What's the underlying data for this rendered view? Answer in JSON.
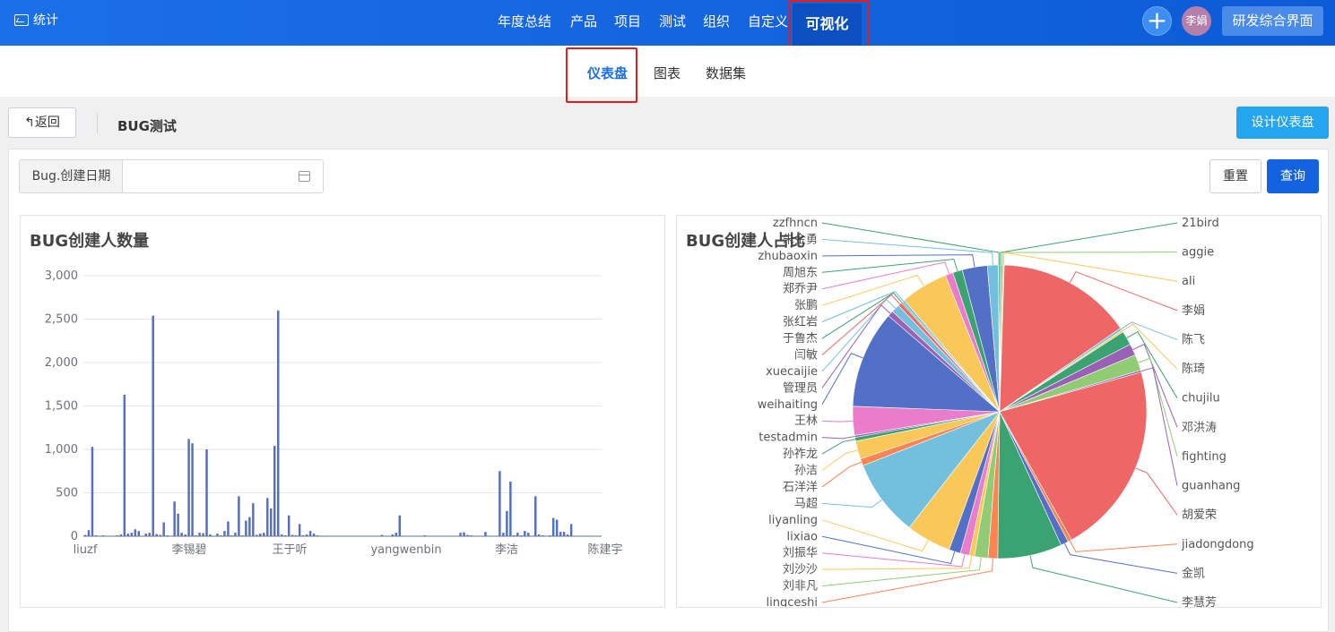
{
  "header": {
    "app_name": "统计",
    "nav": [
      "年度总结",
      "产品",
      "项目",
      "测试",
      "组织",
      "自定义",
      "可视化"
    ],
    "active_nav": "可视化",
    "user_avatar": "李娟",
    "switch_button": "研发综合界面",
    "plus_symbol": "+"
  },
  "subnav": {
    "items": [
      "仪表盘",
      "图表",
      "数据集"
    ],
    "active": "仪表盘"
  },
  "toolbar": {
    "back_label": "返回",
    "title": "BUG测试",
    "design_label": "设计仪表盘"
  },
  "filter": {
    "label": "Bug.创建日期",
    "value": "",
    "reset_label": "重置",
    "query_label": "查询"
  },
  "colors": {
    "header": "#1b6fe8",
    "accent": "#1a6de6",
    "highlight": "#e51c1c",
    "bar": "#5470c6"
  },
  "chart_data": [
    {
      "type": "bar",
      "title": "BUG创建人数量",
      "xlabel": "",
      "ylabel": "",
      "ylim": [
        0,
        3000
      ],
      "yticks": [
        "0",
        "500",
        "1,000",
        "1,500",
        "2,000",
        "2,500",
        "3,000"
      ],
      "x_tick_labels": [
        "liuzf",
        "李锡碧",
        "王于听",
        "yangwenbin",
        "李洁",
        "陈建宇"
      ],
      "grid": true,
      "values": [
        15,
        70,
        1030,
        10,
        5,
        10,
        5,
        0,
        5,
        10,
        20,
        1630,
        30,
        40,
        80,
        60,
        5,
        30,
        40,
        2540,
        25,
        15,
        160,
        10,
        5,
        400,
        260,
        40,
        20,
        1120,
        1070,
        10,
        40,
        35,
        1000,
        20,
        0,
        30,
        10,
        60,
        170,
        10,
        40,
        460,
        10,
        180,
        220,
        380,
        15,
        30,
        40,
        440,
        320,
        1040,
        2600,
        20,
        10,
        240,
        15,
        10,
        140,
        10,
        20,
        60,
        30,
        10,
        5,
        5,
        5,
        5,
        5,
        5,
        5,
        5,
        5,
        5,
        5,
        5,
        5,
        5,
        5,
        5,
        5,
        15,
        5,
        5,
        20,
        40,
        240,
        5,
        5,
        5,
        5,
        5,
        5,
        10,
        5,
        5,
        5,
        5,
        5,
        5,
        5,
        5,
        5,
        40,
        45,
        15,
        10,
        5,
        5,
        5,
        50,
        5,
        5,
        5,
        750,
        40,
        290,
        630,
        10,
        40,
        10,
        60,
        40,
        5,
        460,
        20,
        10,
        5,
        10,
        210,
        190,
        50,
        50,
        20,
        140,
        5,
        5,
        5,
        5,
        5,
        5,
        5,
        5
      ]
    },
    {
      "type": "pie",
      "title": "BUG创建人占比",
      "labels": [
        "21bird",
        "aggie",
        "ali",
        "李娟",
        "陈飞",
        "陈琦",
        "chujilu",
        "邓洪涛",
        "fighting",
        "guanhang",
        "胡爱荣",
        "jiadongdong",
        "金凯",
        "李慧芳",
        "lingceshi",
        "刘非凡",
        "刘沙沙",
        "刘振华",
        "lixiao",
        "liyanling",
        "马超",
        "石洋洋",
        "孙洁",
        "孙祚龙",
        "testadmin",
        "王林",
        "weihaiting",
        "管理员",
        "xuecaijie",
        "闫敏",
        "于鲁杰",
        "张红岩",
        "张鹏",
        "郑乔尹",
        "周旭东",
        "zhubaoxin",
        "朱金勇",
        "zzfhncn"
      ],
      "values": [
        25,
        30,
        15,
        2100,
        40,
        30,
        220,
        180,
        250,
        30,
        3000,
        60,
        120,
        1000,
        150,
        210,
        80,
        140,
        180,
        700,
        1200,
        110,
        280,
        60,
        30,
        450,
        1520,
        90,
        130,
        60,
        20,
        40,
        740,
        120,
        150,
        390,
        170,
        20
      ],
      "colors": [
        "#3ba272",
        "#91cc75",
        "#fac858",
        "#ee6666",
        "#73c0de",
        "#fac858",
        "#3ba272",
        "#9a60b4",
        "#91cc75",
        "#9a60b4",
        "#ee6666",
        "#fc8452",
        "#5470c6",
        "#3ba272",
        "#fc8452",
        "#91cc75",
        "#fac858",
        "#ea7ccc",
        "#5470c6",
        "#fac858",
        "#73c0de",
        "#fc8452",
        "#fac858",
        "#3ba272",
        "#9a60b4",
        "#ea7ccc",
        "#5470c6",
        "#9a60b4",
        "#73c0de",
        "#ee6666",
        "#3ba272",
        "#73c0de",
        "#fac858",
        "#ea7ccc",
        "#3ba272",
        "#5470c6",
        "#73c0de",
        "#3ba272"
      ]
    }
  ]
}
